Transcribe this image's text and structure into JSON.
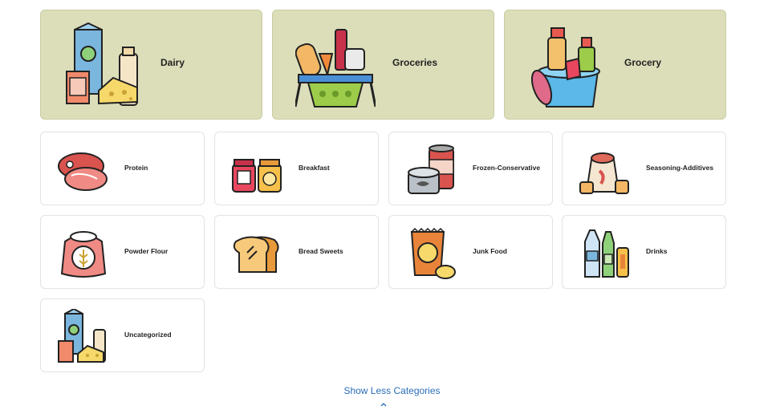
{
  "featured": [
    {
      "label": "Dairy",
      "icon": "dairy-icon"
    },
    {
      "label": "Groceries",
      "icon": "grocery-basket-icon"
    },
    {
      "label": "Grocery",
      "icon": "cleaning-supplies-icon"
    }
  ],
  "categories": [
    {
      "label": "Protein",
      "icon": "meat-icon"
    },
    {
      "label": "Breakfast",
      "icon": "jam-jars-icon"
    },
    {
      "label": "Frozen-Conservative",
      "icon": "canned-food-icon"
    },
    {
      "label": "Seasoning-Additives",
      "icon": "spices-sack-icon"
    },
    {
      "label": "Powder Flour",
      "icon": "flour-sack-icon"
    },
    {
      "label": "Bread Sweets",
      "icon": "bread-icon"
    },
    {
      "label": "Junk Food",
      "icon": "chips-bag-icon"
    },
    {
      "label": "Drinks",
      "icon": "bottles-icon"
    },
    {
      "label": "Uncategorized",
      "icon": "dairy-icon"
    }
  ],
  "footer": {
    "toggle_label": "Show Less Categories",
    "toggle_icon": "chevron-up-icon"
  },
  "colors": {
    "featured_bg": "#dcdeba",
    "link": "#2a6db8"
  }
}
